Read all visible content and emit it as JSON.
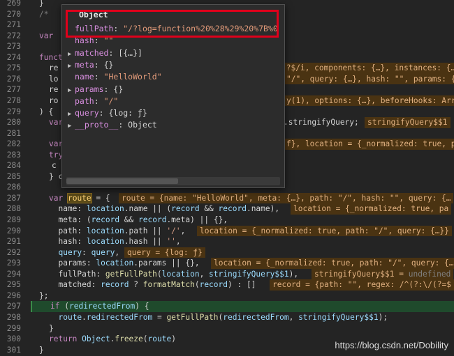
{
  "lines": [
    {
      "n": "269",
      "t": "}"
    },
    {
      "n": "270",
      "t": "/*"
    },
    {
      "n": "271",
      "t": ""
    },
    {
      "n": "272",
      "t": "var"
    },
    {
      "n": "273",
      "t": ""
    },
    {
      "n": "274",
      "t": "funct"
    },
    {
      "n": "275",
      "t": "re"
    },
    {
      "n": "276",
      "t": "lo"
    },
    {
      "n": "277",
      "t": "re"
    },
    {
      "n": "278",
      "t": "ro"
    },
    {
      "n": "279",
      "t": ") {"
    },
    {
      "n": "280",
      "t": "var"
    },
    {
      "n": "281",
      "t": ""
    },
    {
      "n": "282",
      "t": "var"
    },
    {
      "n": "283",
      "t": "try"
    },
    {
      "n": "284",
      "t": "c"
    },
    {
      "n": "285",
      "t": "} c"
    },
    {
      "n": "286",
      "t": ""
    },
    {
      "n": "287",
      "t": "var route = {"
    },
    {
      "n": "288",
      "t": "  name: location.name || (record && record.name),"
    },
    {
      "n": "289",
      "t": "  meta: (record && record.meta) || {},"
    },
    {
      "n": "290",
      "t": "  path: location.path || '/',"
    },
    {
      "n": "291",
      "t": "  hash: location.hash || '',"
    },
    {
      "n": "292",
      "t": "  query: query,"
    },
    {
      "n": "293",
      "t": "  params: location.params || {},"
    },
    {
      "n": "294",
      "t": "  fullPath: getFullPath(location, stringifyQuery$$1),"
    },
    {
      "n": "295",
      "t": "  matched: record ? formatMatch(record) : []"
    },
    {
      "n": "296",
      "t": "};"
    },
    {
      "n": "297",
      "t": "if (redirectedFrom) {"
    },
    {
      "n": "298",
      "t": "  route.redirectedFrom = getFullPath(redirectedFrom, stringifyQuery$$1);"
    },
    {
      "n": "299",
      "t": "}"
    },
    {
      "n": "300",
      "t": "return Object.freeze(route)"
    },
    {
      "n": "301",
      "t": "}"
    }
  ],
  "inline_values": {
    "l275": ")?$/i, components: {…}, instances: {…",
    "l276": "\"/\", query: {…}, hash: \"\", params: {…",
    "l278": "y(1), options: {…}, beforeHooks: Arr",
    "l280a": ".stringifyQuery;",
    "l280b": "stringifyQuery$$1",
    "l282": "f}, location = {_normalized: true, pa",
    "l287": "route = {name: \"HelloWorld\", meta: {…}, path: \"/\", hash: \"\", query: {…",
    "l288": "location = {_normalized: true, pa",
    "l290": "location = {_normalized: true, path: \"/\", query: {…}}",
    "l292": "query = {log: ƒ}",
    "l293": "location = {_normalized: true, path: \"/\", query: {…",
    "l294a": "stringifyQuery$$1 =",
    "l294b": "undefined",
    "l295": "record = {path: \"\", regex: /^(?:\\/(?=$",
    "l293_trailing": ""
  },
  "popup": {
    "title": "Object",
    "rows": [
      {
        "key": "fullPath",
        "sep": ": ",
        "val": "\"/?log=function%20%28%29%20%7B%0"
      },
      {
        "key": "hash",
        "sep": ": ",
        "val": "\"\""
      },
      {
        "key": "matched",
        "sep": ": ",
        "val": "[{…}]",
        "arrow": true
      },
      {
        "key": "meta",
        "sep": ": ",
        "val": "{}",
        "arrow": true
      },
      {
        "key": "name",
        "sep": ": ",
        "val": "\"HelloWorld\""
      },
      {
        "key": "params",
        "sep": ": ",
        "val": "{}",
        "arrow": true
      },
      {
        "key": "path",
        "sep": ": ",
        "val": "\"/\""
      },
      {
        "key": "query",
        "sep": ": ",
        "val": "{log: ƒ}",
        "arrow": true
      },
      {
        "key": "__proto__",
        "sep": ": ",
        "val": "Object",
        "arrow": true
      }
    ]
  },
  "watermark": "https://blog.csdn.net/Dobility"
}
